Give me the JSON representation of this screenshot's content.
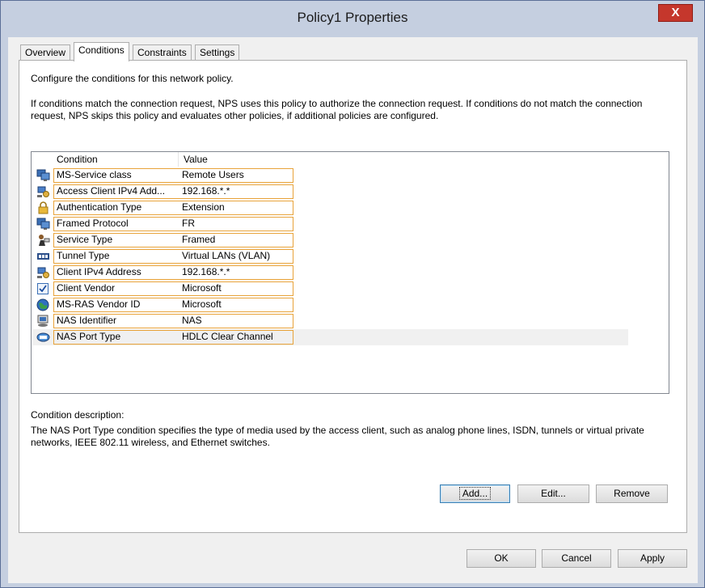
{
  "window": {
    "title": "Policy1 Properties",
    "close_label": "X"
  },
  "tabs": [
    {
      "label": "Overview",
      "active": false
    },
    {
      "label": "Conditions",
      "active": true
    },
    {
      "label": "Constraints",
      "active": false
    },
    {
      "label": "Settings",
      "active": false
    }
  ],
  "intro": "Configure the conditions for this network policy.",
  "explanation": "If conditions match the connection request, NPS uses this policy to authorize the connection request. If conditions do not match the connection request, NPS skips this policy and evaluates other policies, if additional policies are configured.",
  "conditions_list": {
    "columns": [
      "Condition",
      "Value"
    ],
    "rows": [
      {
        "icon": "network-computer-icon",
        "condition": "MS-Service class",
        "value": "Remote Users"
      },
      {
        "icon": "ip-address-icon",
        "condition": "Access Client IPv4 Add...",
        "value": "192.168.*.*"
      },
      {
        "icon": "lock-icon",
        "condition": "Authentication Type",
        "value": "Extension"
      },
      {
        "icon": "network-computer-icon",
        "condition": "Framed Protocol",
        "value": "FR"
      },
      {
        "icon": "service-type-icon",
        "condition": "Service Type",
        "value": "Framed"
      },
      {
        "icon": "tunnel-icon",
        "condition": "Tunnel Type",
        "value": "Virtual LANs (VLAN)"
      },
      {
        "icon": "ip-address-icon",
        "condition": "Client IPv4 Address",
        "value": "192.168.*.*"
      },
      {
        "icon": "checkbox-icon",
        "condition": "Client Vendor",
        "value": "Microsoft"
      },
      {
        "icon": "globe-icon",
        "condition": "MS-RAS Vendor ID",
        "value": "Microsoft"
      },
      {
        "icon": "nas-identifier-icon",
        "condition": "NAS Identifier",
        "value": "NAS"
      },
      {
        "icon": "port-type-icon",
        "condition": "NAS Port Type",
        "value": "HDLC Clear Channel"
      }
    ]
  },
  "description": {
    "label": "Condition description:",
    "text": "The NAS Port Type condition specifies the type of media used by the access client, such as analog phone lines, ISDN, tunnels or virtual private networks, IEEE 802.11 wireless, and Ethernet switches."
  },
  "buttons": {
    "add": "Add...",
    "edit": "Edit...",
    "remove": "Remove",
    "ok": "OK",
    "cancel": "Cancel",
    "apply": "Apply"
  },
  "colors": {
    "accent_border": "#e8a33a",
    "title_bar": "#c5cfe0",
    "close": "#c5372c"
  }
}
